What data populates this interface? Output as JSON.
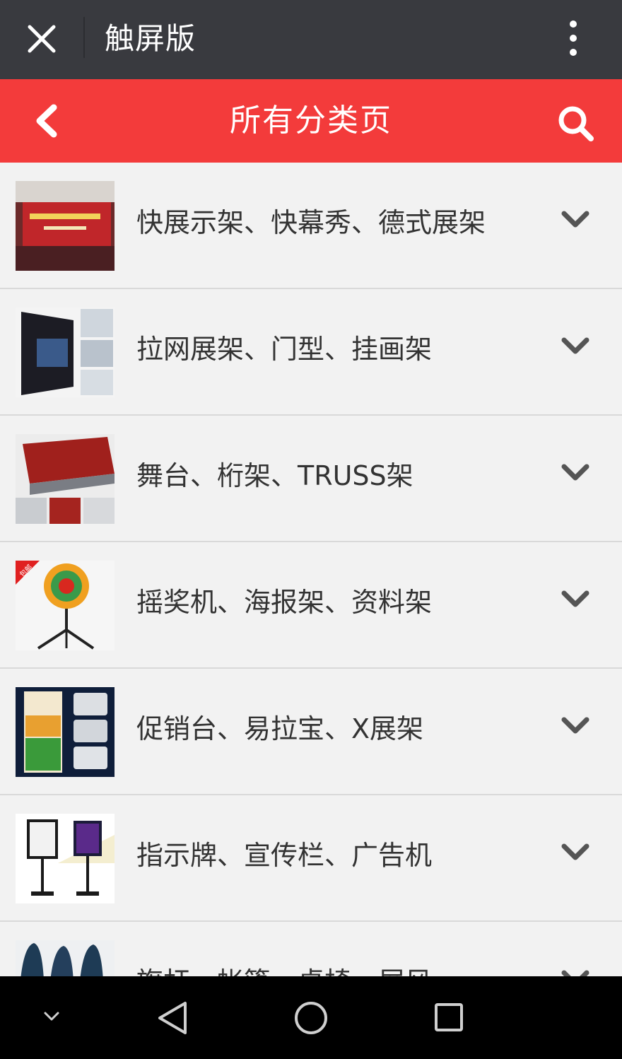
{
  "wechat_bar": {
    "title": "触屏版",
    "close_icon": "close-icon",
    "more_icon": "more-vertical-icon"
  },
  "header": {
    "title": "所有分类页",
    "back_icon": "chevron-left-icon",
    "search_icon": "search-icon",
    "color": "#f33b3b"
  },
  "categories": [
    {
      "label": "快展示架、快幕秀、德式展架",
      "thumb": "banner-stage-photo"
    },
    {
      "label": "拉网展架、门型、挂画架",
      "thumb": "popup-display-photo"
    },
    {
      "label": "舞台、桁架、TRUSS架",
      "thumb": "stage-platform-photo"
    },
    {
      "label": "摇奖机、海报架、资料架",
      "thumb": "prize-wheel-photo",
      "badge": "包邮"
    },
    {
      "label": "促销台、易拉宝、X展架",
      "thumb": "rollup-banner-photo"
    },
    {
      "label": "指示牌、宣传栏、广告机",
      "thumb": "sign-stand-photo"
    },
    {
      "label": "旗杆、帐篷、桌椅、展风",
      "thumb": "flag-banner-photo"
    }
  ],
  "navbar": {
    "icons": [
      "hide-keyboard-icon",
      "back-triangle-icon",
      "home-circle-icon",
      "recents-square-icon"
    ]
  }
}
